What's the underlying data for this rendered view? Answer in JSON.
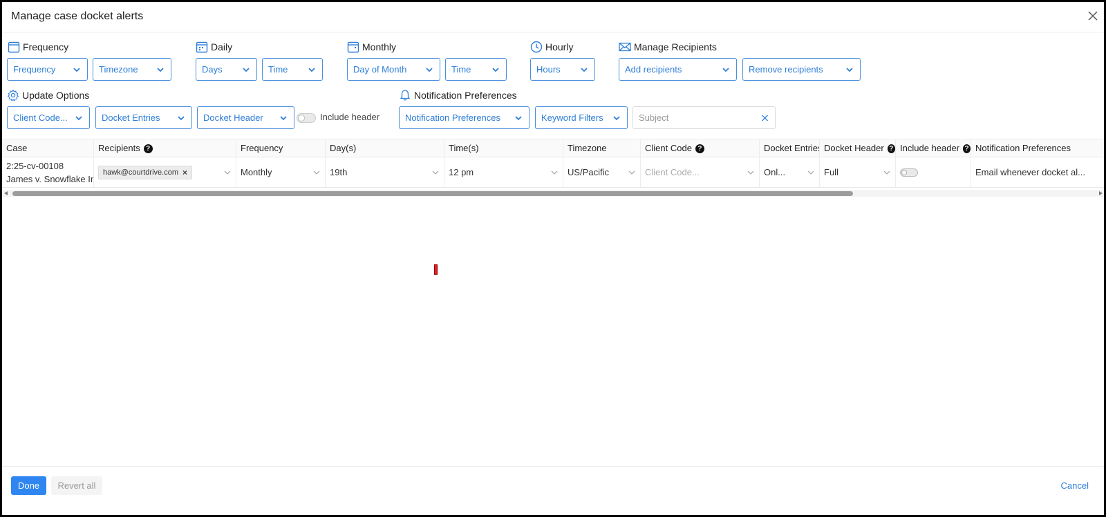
{
  "modal": {
    "title": "Manage case docket alerts"
  },
  "toolbar": {
    "frequency_group": {
      "label": "Frequency",
      "frequency_select": "Frequency",
      "timezone_select": "Timezone"
    },
    "daily_group": {
      "label": "Daily",
      "days_select": "Days",
      "time_select": "Time"
    },
    "monthly_group": {
      "label": "Monthly",
      "day_of_month_select": "Day of Month",
      "time_select": "Time"
    },
    "hourly_group": {
      "label": "Hourly",
      "hours_select": "Hours"
    },
    "recipients_group": {
      "label": "Manage Recipients",
      "add_select": "Add recipients",
      "remove_select": "Remove recipients"
    },
    "update_group": {
      "label": "Update Options",
      "client_code_select": "Client Code...",
      "docket_entries_select": "Docket Entries",
      "docket_header_select": "Docket Header",
      "include_header_label": "Include header"
    },
    "notification_group": {
      "label": "Notification Preferences",
      "notification_select": "Notification Preferences",
      "keyword_select": "Keyword Filters",
      "subject_placeholder": "Subject"
    }
  },
  "table": {
    "columns": [
      "Case",
      "Recipients",
      "Frequency",
      "Day(s)",
      "Time(s)",
      "Timezone",
      "Client Code",
      "Docket Entries",
      "Docket Header",
      "Include header",
      "Notification Preferences"
    ],
    "rows": [
      {
        "case_number": "2:25-cv-00108",
        "case_name": "James v. Snowflake Inc",
        "recipient": "hawk@courtdrive.com",
        "frequency": "Monthly",
        "days": "19th",
        "times": "12 pm",
        "timezone": "US/Pacific",
        "client_code_placeholder": "Client Code...",
        "docket_entries": "Onl...",
        "docket_header": "Full",
        "include_header": false,
        "notification_preferences": "Email whenever docket al..."
      }
    ]
  },
  "footer": {
    "done_label": "Done",
    "revert_label": "Revert all",
    "cancel_label": "Cancel"
  },
  "colors": {
    "accent": "#2d7ed8",
    "primary_button": "#2f86f0"
  }
}
